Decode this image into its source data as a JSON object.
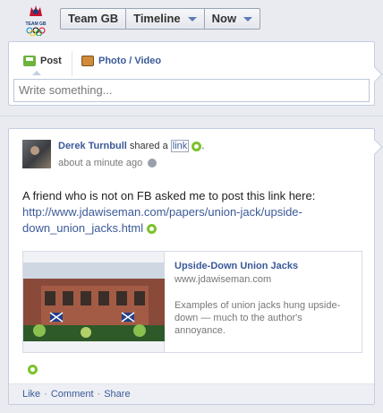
{
  "header": {
    "logo_text": "TEAM GB",
    "segments": [
      {
        "label": "Team GB"
      },
      {
        "label": "Timeline"
      },
      {
        "label": "Now"
      }
    ]
  },
  "composer": {
    "tab_post": "Post",
    "tab_photo": "Photo / Video",
    "placeholder": "Write something..."
  },
  "story": {
    "actor": "Derek Turnbull",
    "verb": "shared a",
    "object": "link",
    "period": ".",
    "time": "about a minute ago",
    "message": "A friend who is not on FB asked me to post this link here:",
    "url": "http://www.jdawiseman.com/papers/union-jack/upside-down_union_jacks.html",
    "attachment": {
      "title": "Upside-Down Union Jacks",
      "domain": "www.jdawiseman.com",
      "description": "Examples of union jacks hung upside-down — much to the author's annoyance."
    },
    "actions": {
      "like": "Like",
      "comment": "Comment",
      "share": "Share",
      "separator": "·"
    }
  },
  "colors": {
    "accent": "#3b5998",
    "ring": "#7cc22c",
    "background": "#e9ebf0"
  },
  "icons": [
    "team-gb-logo",
    "caret-down-icon",
    "post-icon",
    "photo-icon",
    "globe-icon",
    "ring-icon"
  ]
}
